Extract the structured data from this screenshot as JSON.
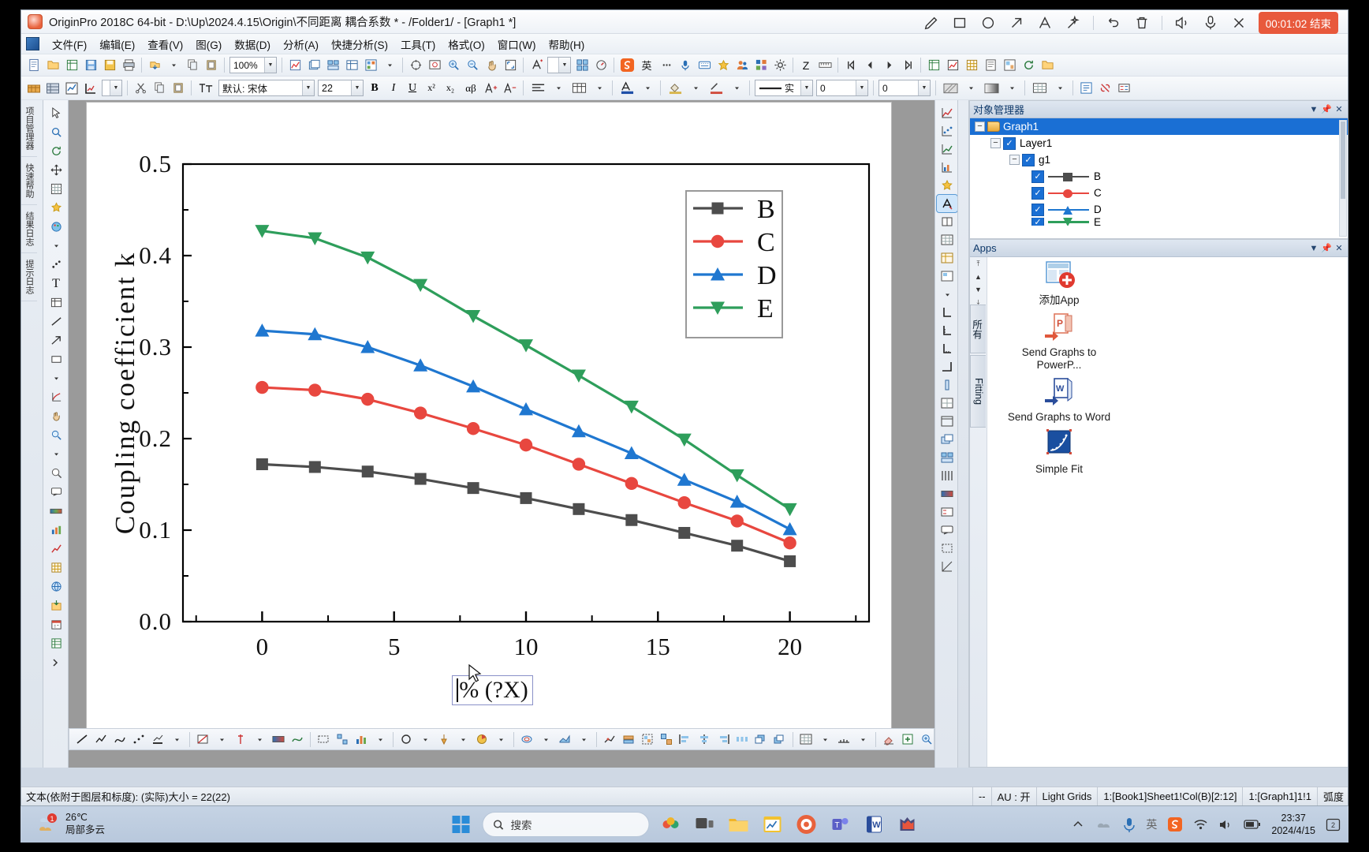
{
  "window": {
    "title": "OriginPro 2018C 64-bit - D:\\Up\\2024.4.15\\Origin\\不同距离 耦合系数 * - /Folder1/ - [Graph1 *]",
    "graph_tab_number": "1"
  },
  "recorder": {
    "timer": "00:01:02 结束",
    "tools": [
      "pencil-icon",
      "rectangle-icon",
      "ellipse-icon",
      "arrow-icon",
      "text-icon",
      "magic-wand-icon",
      "undo-icon",
      "trash-icon",
      "speaker-icon",
      "microphone-icon",
      "close-icon"
    ]
  },
  "menu": {
    "items": [
      {
        "label": "文件(F)"
      },
      {
        "label": "编辑(E)"
      },
      {
        "label": "查看(V)"
      },
      {
        "label": "图(G)"
      },
      {
        "label": "数据(D)"
      },
      {
        "label": "分析(A)"
      },
      {
        "label": "快捷分析(S)"
      },
      {
        "label": "工具(T)"
      },
      {
        "label": "格式(O)"
      },
      {
        "label": "窗口(W)"
      },
      {
        "label": "帮助(H)"
      }
    ]
  },
  "toolbar": {
    "zoom_value": "100%",
    "font_name": "默认: 宋体",
    "font_size": "22",
    "line_style": "实",
    "line_width": "0",
    "fill_value": "0",
    "bold_label": "B",
    "italic_label": "I",
    "underline_label": "U",
    "superscript_label": "x²",
    "subscript_label": "x₂",
    "greek_label": "αβ",
    "text_tool_label": "A",
    "ime_label": "英",
    "z_label": "Z"
  },
  "graph_toolbar": {
    "line_width_value": "10"
  },
  "object_manager": {
    "title": "对象管理器",
    "nodes": [
      {
        "label": "Graph1",
        "level": 0,
        "type": "folder",
        "selected": true,
        "expander": "−"
      },
      {
        "label": "Layer1",
        "level": 1,
        "type": "check",
        "expander": "−"
      },
      {
        "label": "g1",
        "level": 2,
        "type": "check",
        "expander": "−"
      },
      {
        "label": "B",
        "level": 3,
        "type": "plot",
        "color": "#4d4d4d",
        "marker": "square"
      },
      {
        "label": "C",
        "level": 3,
        "type": "plot",
        "color": "#e8473f",
        "marker": "circle"
      },
      {
        "label": "D",
        "level": 3,
        "type": "plot",
        "color": "#1f77d0",
        "marker": "triangle-up"
      },
      {
        "label": "E",
        "level": 3,
        "type": "plot",
        "color": "#2e9e5b",
        "marker": "triangle-down"
      }
    ]
  },
  "apps": {
    "title": "Apps",
    "tabs": [
      "所有",
      "Fitting"
    ],
    "items": [
      {
        "label": "添加App",
        "icon": "add-app-icon"
      },
      {
        "label": "Send Graphs to PowerP...",
        "icon": "powerpoint-icon"
      },
      {
        "label": "Send Graphs to Word",
        "icon": "word-icon"
      },
      {
        "label": "Simple Fit",
        "icon": "simple-fit-icon"
      }
    ]
  },
  "statusbar": {
    "left": "文本(依附于图层和标度): (实际)大小 = 22(22)",
    "cells": [
      "--",
      "AU : 开",
      "Light Grids",
      "1:[Book1]Sheet1!Col(B)[2:12]",
      "1:[Graph1]1!1",
      "弧度"
    ]
  },
  "taskbar": {
    "weather_temp": "26℃",
    "weather_desc": "局部多云",
    "weather_badge": "1",
    "search_placeholder": "搜索",
    "clock_time": "23:37",
    "clock_date": "2024/4/15",
    "tray_icons": [
      "chevron-up-icon",
      "cloud-icon",
      "microphone-icon",
      "ime-english-icon",
      "sogou-icon",
      "wifi-icon",
      "volume-icon",
      "battery-icon",
      "notification-icon"
    ]
  },
  "editing_label": {
    "text": "% (?X)",
    "has_caret": true
  },
  "chart_data": {
    "type": "line",
    "title": "",
    "xlabel": "% (?X)",
    "ylabel": "Coupling coefficient k",
    "xlim": [
      -3,
      23
    ],
    "ylim": [
      0.0,
      0.5
    ],
    "xticks": [
      0,
      5,
      10,
      15,
      20
    ],
    "xtick_labels": [
      "0",
      "5",
      "10",
      "15",
      "20"
    ],
    "yticks": [
      0.0,
      0.1,
      0.2,
      0.3,
      0.4,
      0.5
    ],
    "ytick_labels": [
      "0.0",
      "0.1",
      "0.2",
      "0.3",
      "0.4",
      "0.5"
    ],
    "grid": false,
    "legend_position": "top-right",
    "x": [
      0,
      2,
      4,
      6,
      8,
      10,
      12,
      14,
      16,
      18,
      20
    ],
    "series": [
      {
        "name": "B",
        "color": "#4d4d4d",
        "marker": "square",
        "values": [
          0.172,
          0.169,
          0.164,
          0.156,
          0.146,
          0.135,
          0.123,
          0.111,
          0.097,
          0.083,
          0.066
        ]
      },
      {
        "name": "C",
        "color": "#e8473f",
        "marker": "circle",
        "values": [
          0.256,
          0.253,
          0.243,
          0.228,
          0.211,
          0.193,
          0.172,
          0.151,
          0.13,
          0.11,
          0.086
        ]
      },
      {
        "name": "D",
        "color": "#1f77d0",
        "marker": "triangle-up",
        "values": [
          0.318,
          0.314,
          0.3,
          0.28,
          0.257,
          0.232,
          0.208,
          0.184,
          0.155,
          0.131,
          0.101
        ]
      },
      {
        "name": "E",
        "color": "#2e9e5b",
        "marker": "triangle-down",
        "values": [
          0.427,
          0.419,
          0.398,
          0.368,
          0.334,
          0.302,
          0.269,
          0.235,
          0.199,
          0.16,
          0.123
        ]
      }
    ]
  }
}
